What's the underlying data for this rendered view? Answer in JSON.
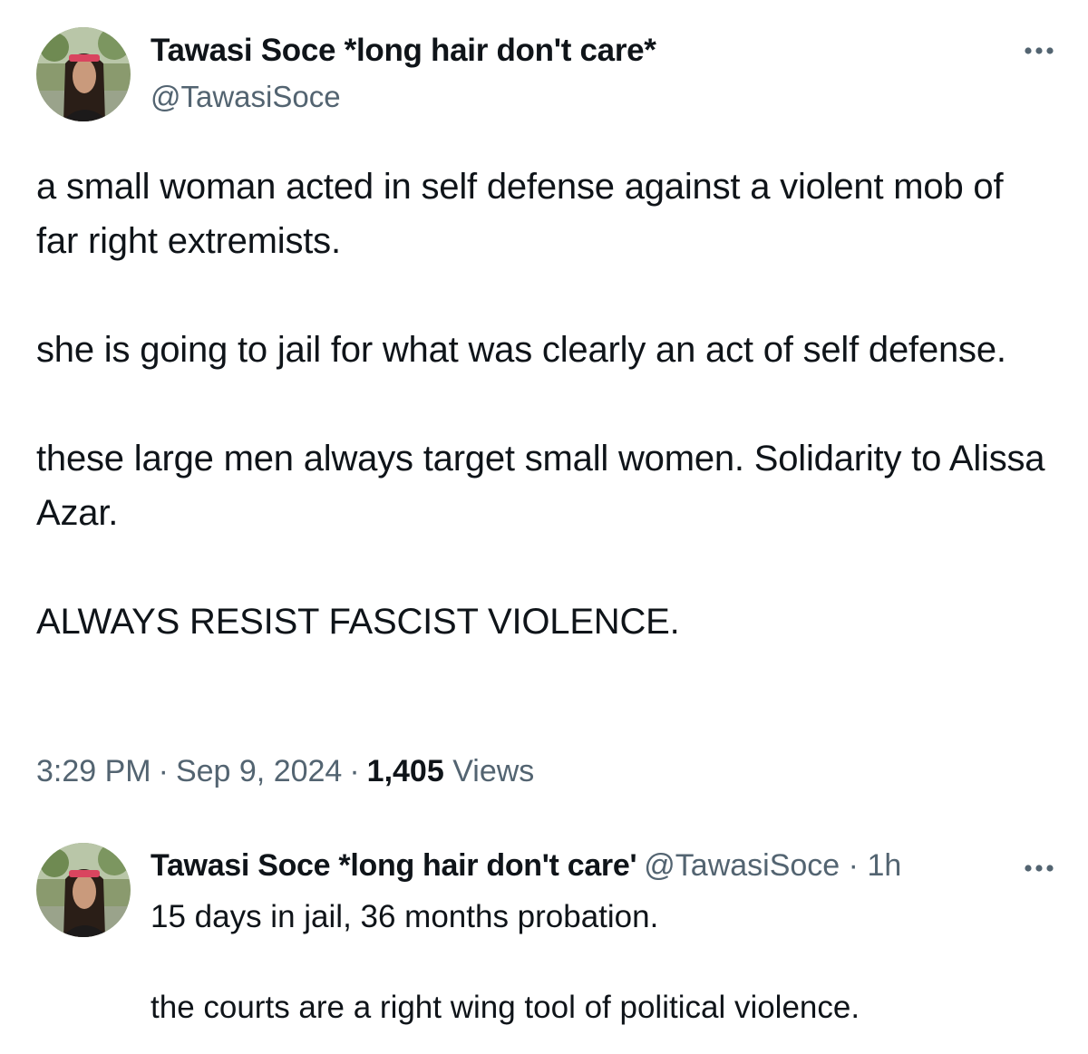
{
  "main_tweet": {
    "author": {
      "display_name": "Tawasi Soce *long hair don't care*",
      "handle": "@TawasiSoce",
      "avatar_icon": "profile-photo"
    },
    "more_icon": "ellipsis-icon",
    "paragraphs": [
      "a small woman acted in self defense against a violent mob of far right extremists.",
      "she is going to jail for what was clearly an act of self defense.",
      "these large men always target small women. Solidarity to Alissa Azar.",
      "ALWAYS RESIST FASCIST VIOLENCE."
    ],
    "time": "3:29 PM",
    "date": "Sep 9, 2024",
    "separator": "·",
    "views_count": "1,405",
    "views_label": "Views"
  },
  "reply_tweet": {
    "author": {
      "display_name": "Tawasi Soce *long hair don't care'",
      "handle": "@TawasiSoce",
      "avatar_icon": "profile-photo"
    },
    "separator": "·",
    "time_ago": "1h",
    "more_icon": "ellipsis-icon",
    "paragraphs": [
      "15 days in jail, 36 months probation.",
      "the courts are a right wing tool of political violence."
    ]
  },
  "colors": {
    "text_primary": "#0f1419",
    "text_secondary": "#536471",
    "background": "#ffffff",
    "bandana": "#d9455f"
  }
}
